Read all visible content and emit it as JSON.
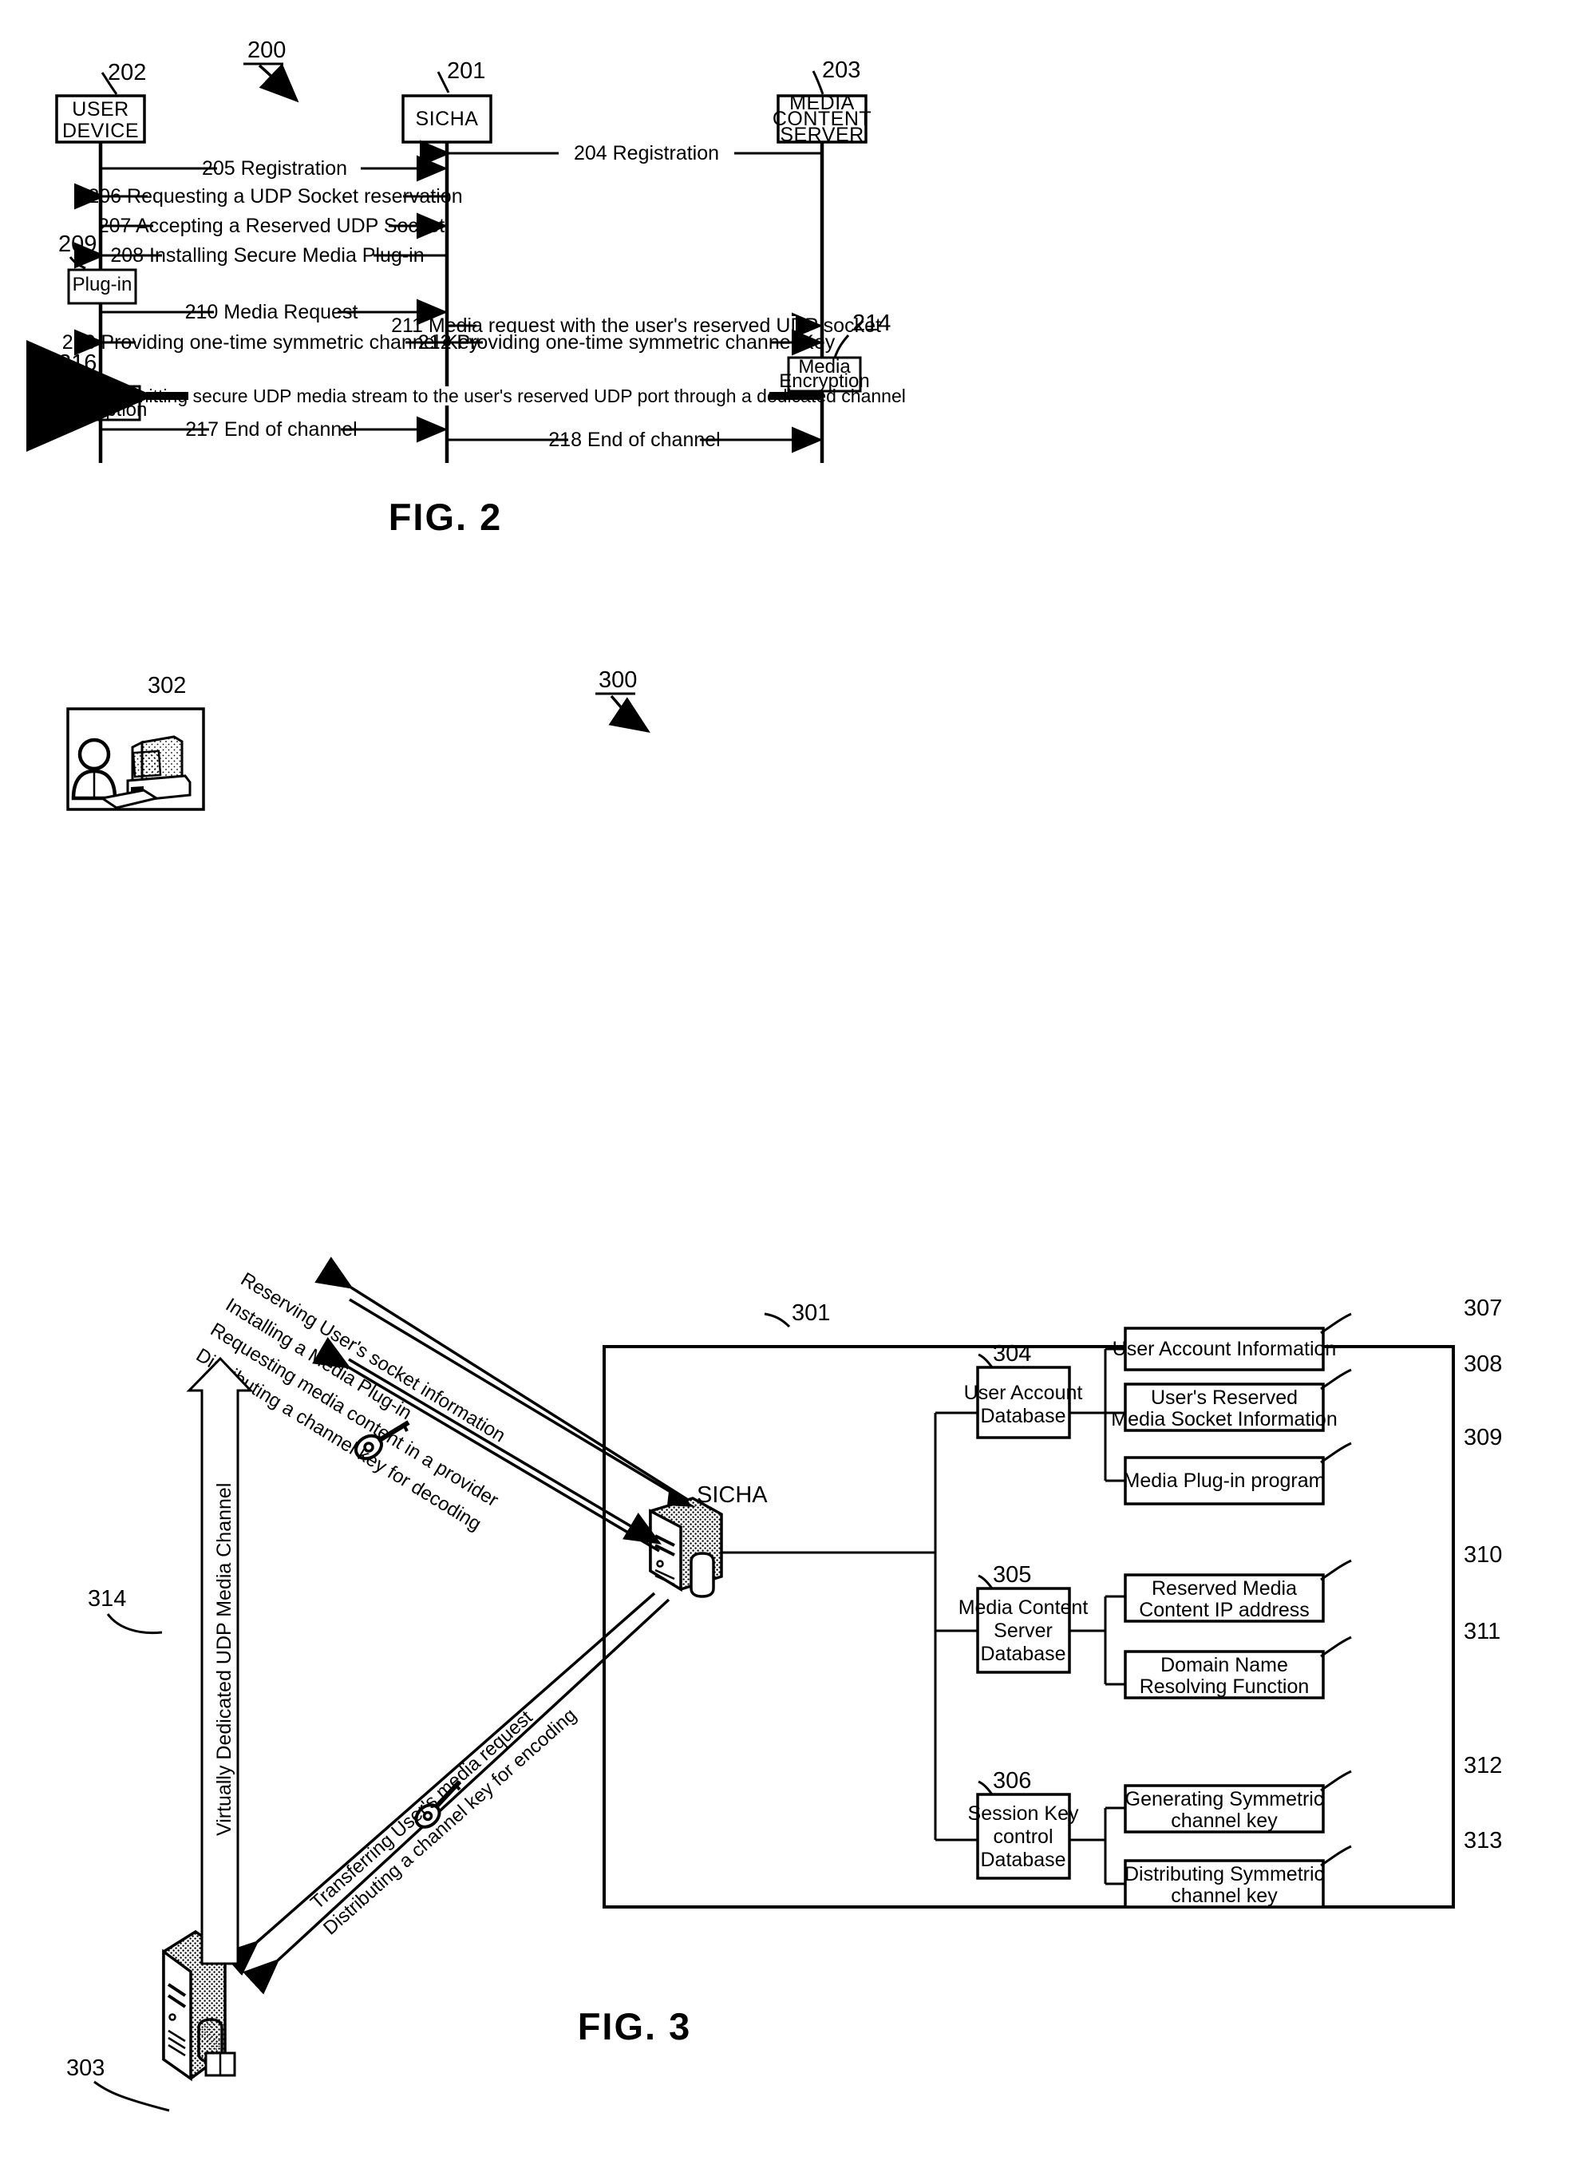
{
  "figure2": {
    "fig_label": "FIG. 2",
    "ref_number": "200",
    "lifelines": [
      {
        "ref": "202",
        "label_line1": "USER",
        "label_line2": "DEVICE"
      },
      {
        "ref": "201",
        "label_line1": "SICHA",
        "label_line2": ""
      },
      {
        "ref": "203",
        "label_line1": "MEDIA",
        "label_line2": "CONTENT",
        "label_line3": "SERVER"
      }
    ],
    "messages": [
      {
        "num": "204",
        "text": "204  Registration"
      },
      {
        "num": "205",
        "text": "205  Registration"
      },
      {
        "num": "206",
        "text": "206  Requesting a UDP Socket reservation"
      },
      {
        "num": "207",
        "text": "207  Accepting a Reserved UDP Socket"
      },
      {
        "num": "208",
        "text": "208  Installing Secure Media Plug-in"
      },
      {
        "num": "210",
        "text": "210  Media Request"
      },
      {
        "num": "211",
        "text": "211  Media request with the user's reserved UDP socket"
      },
      {
        "num": "213",
        "text": "213  Providing one-time symmetric channel Key"
      },
      {
        "num": "212",
        "text": "212  Providing one-time symmetric channel Key"
      },
      {
        "num": "215",
        "text": "215  Transmitting secure UDP media stream to the user's reserved UDP port through a dedicated channel"
      },
      {
        "num": "217",
        "text": "217  End of channel"
      },
      {
        "num": "218",
        "text": "218  End of channel"
      }
    ],
    "activation_boxes": [
      {
        "ref": "209",
        "label_line1": "Plug-in",
        "label_line2": ""
      },
      {
        "ref": "214",
        "label_line1": "Media",
        "label_line2": "Encryption"
      },
      {
        "ref": "216",
        "label_line1": "Media",
        "label_line2": "Decryption"
      }
    ]
  },
  "figure3": {
    "fig_label": "FIG. 3",
    "ref_number": "300",
    "container_ref": "301",
    "user_panel_ref": "302",
    "bottom_server_ref": "303",
    "channel_ref": "314",
    "channel_label": "Virtually Dedicated UDP Media Channel",
    "sicha_label": "SICHA",
    "upper_arrow_labels": [
      "Reserving User's socket information",
      "Installing a  Media Plug-in",
      "Requesting media content in a provider",
      "Distributing a channel key for decoding"
    ],
    "lower_arrow_labels": [
      "Transferring User's media request",
      "Distributing a channel key for encoding"
    ],
    "databases": [
      {
        "ref": "304",
        "lines": [
          "User Account",
          "Database"
        ]
      },
      {
        "ref": "305",
        "lines": [
          "Media Content",
          "Server",
          "Database"
        ]
      },
      {
        "ref": "306",
        "lines": [
          "Session Key",
          "control",
          "Database"
        ]
      }
    ],
    "functions": [
      {
        "ref": "307",
        "lines": [
          "User Account Information"
        ]
      },
      {
        "ref": "308",
        "lines": [
          "User's Reserved",
          "Media Socket Information"
        ]
      },
      {
        "ref": "309",
        "lines": [
          "Media Plug-in program"
        ]
      },
      {
        "ref": "310",
        "lines": [
          "Reserved Media",
          "Content IP address"
        ]
      },
      {
        "ref": "311",
        "lines": [
          "Domain Name",
          "Resolving Function"
        ]
      },
      {
        "ref": "312",
        "lines": [
          "Generating Symmetric",
          "channel key"
        ]
      },
      {
        "ref": "313",
        "lines": [
          "Distributing Symmetric",
          "channel key"
        ]
      }
    ]
  }
}
